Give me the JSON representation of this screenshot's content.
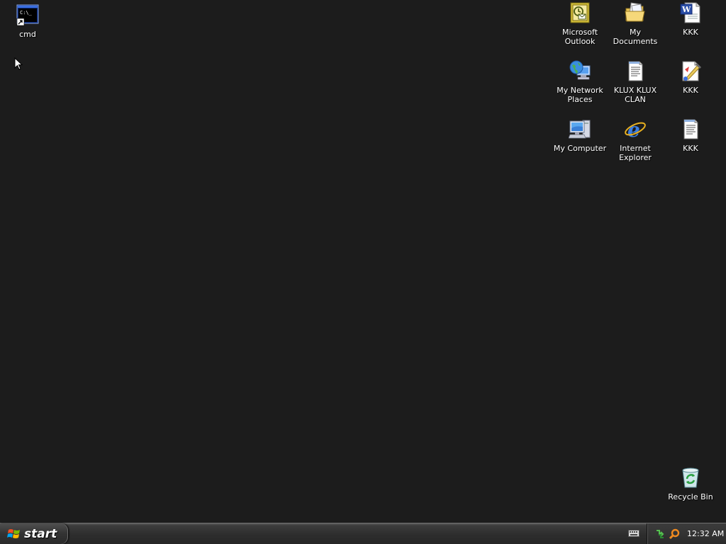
{
  "desktop": {
    "background_color": "#1c1c1c",
    "icons": {
      "cmd": {
        "label": "cmd",
        "icon": "command-prompt-shortcut-icon"
      },
      "outlook": {
        "label": "Microsoft Outlook",
        "icon": "outlook-icon"
      },
      "my_documents": {
        "label": "My Documents",
        "icon": "folder-icon"
      },
      "kkk_word": {
        "label": "KKK",
        "icon": "word-document-icon"
      },
      "my_network_places": {
        "label": "My Network Places",
        "icon": "network-places-icon"
      },
      "klux": {
        "label": "KLUX KLUX CLAN",
        "icon": "text-document-icon"
      },
      "kkk_paint": {
        "label": "KKK",
        "icon": "paint-image-icon"
      },
      "my_computer": {
        "label": "My Computer",
        "icon": "computer-icon"
      },
      "internet_explorer": {
        "label": "Internet Explorer",
        "icon": "internet-explorer-icon"
      },
      "kkk_text": {
        "label": "KKK",
        "icon": "text-document-icon"
      },
      "recycle_bin": {
        "label": "Recycle Bin",
        "icon": "recycle-bin-icon"
      }
    }
  },
  "taskbar": {
    "start_label": "start",
    "clock": "12:32 AM",
    "tray_icons": [
      "network-icon",
      "search-icon"
    ],
    "quick_icons": [
      "keyboard-icon"
    ]
  }
}
